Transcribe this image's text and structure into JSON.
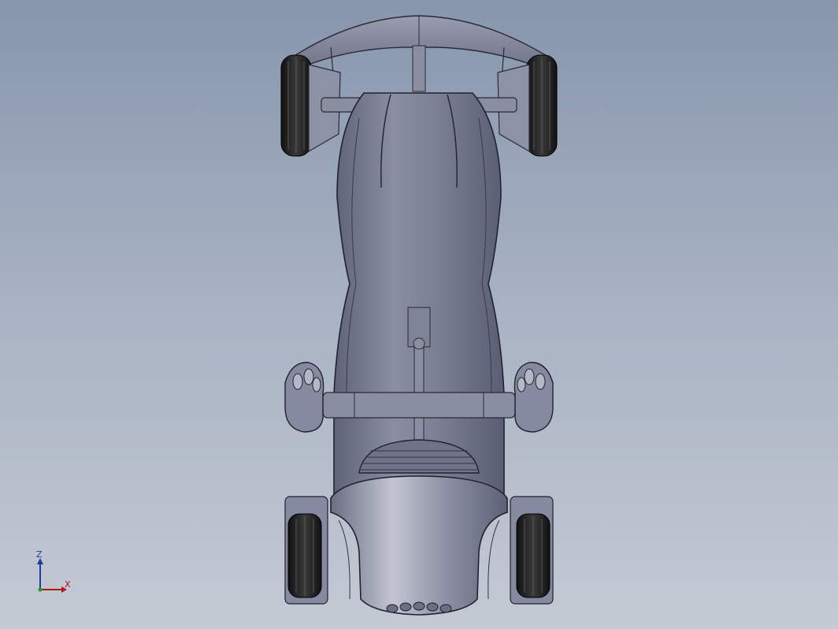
{
  "viewport": {
    "background_top": "#8796ad",
    "background_bottom": "#c4cad4",
    "model": {
      "name": "hot-rod-car",
      "view": "top",
      "body_color": "#7d8195",
      "tire_color": "#1a1a1a"
    }
  },
  "triad": {
    "z_label": "Z",
    "x_label": "X",
    "z_color": "#1f3c9c",
    "x_color": "#b01818",
    "origin_color": "#1b9a2a"
  }
}
